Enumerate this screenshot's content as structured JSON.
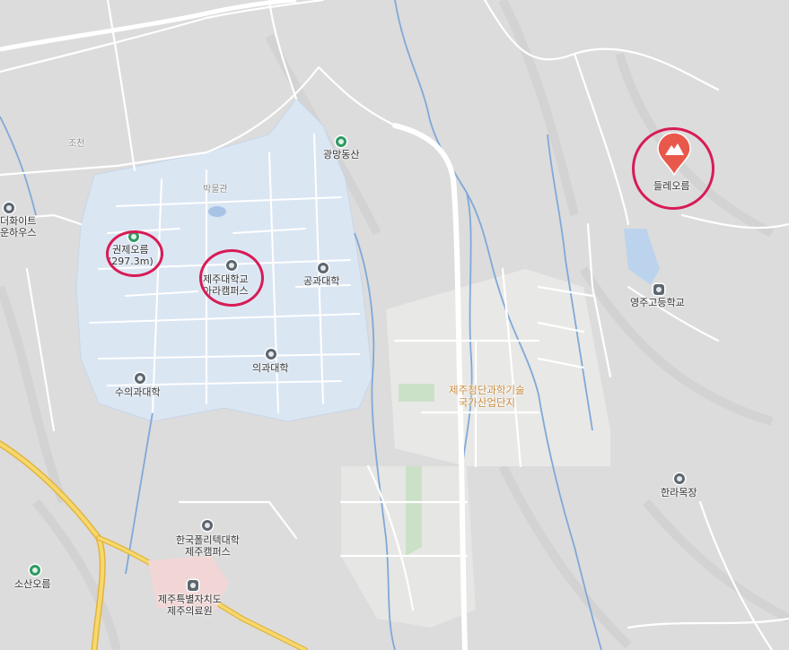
{
  "colors": {
    "terrain": "#dcdcdc",
    "campus": "#dbe6f3",
    "industrial": "#e7e7e5",
    "road": "#ffffff",
    "highway": "#f3cf5c",
    "river": "#7fa9d8",
    "park": "#c9e0c6",
    "highlight_ring": "#d81b55",
    "marker": "#e8594b"
  },
  "labels": {
    "gwonje_oreum": "권제오름",
    "gwonje_height": "(297.3m)",
    "jnu_line1": "제주대학교",
    "jnu_line2": "아라캠퍼스",
    "engineering": "공과대학",
    "medical": "의과대학",
    "veterinary": "수의과대학",
    "museum": "박물관",
    "gwangmangdongsan": "광망동산",
    "dulle_oreum": "들레오름",
    "youngju_highschool": "영주고등학교",
    "halla_ranch": "한라목장",
    "science_park_line1": "제주첨단과학기술",
    "science_park_line2": "국가산업단지",
    "polytech_line1": "한국폴리텍대학",
    "polytech_line2": "제주캠퍼스",
    "medical_center_line1": "제주특별자치도",
    "medical_center_line2": "제주의료원",
    "sosan_oreum": "소산오름",
    "the_white_line1": "더화이트",
    "the_white_line2": "운하우스",
    "stream": "조천"
  },
  "icons": {
    "mountain_green": "mountain-icon",
    "university": "university-icon",
    "school": "school-icon",
    "place": "place-icon",
    "hospital": "hospital-icon",
    "peak_marker": "mountain-marker-icon"
  }
}
